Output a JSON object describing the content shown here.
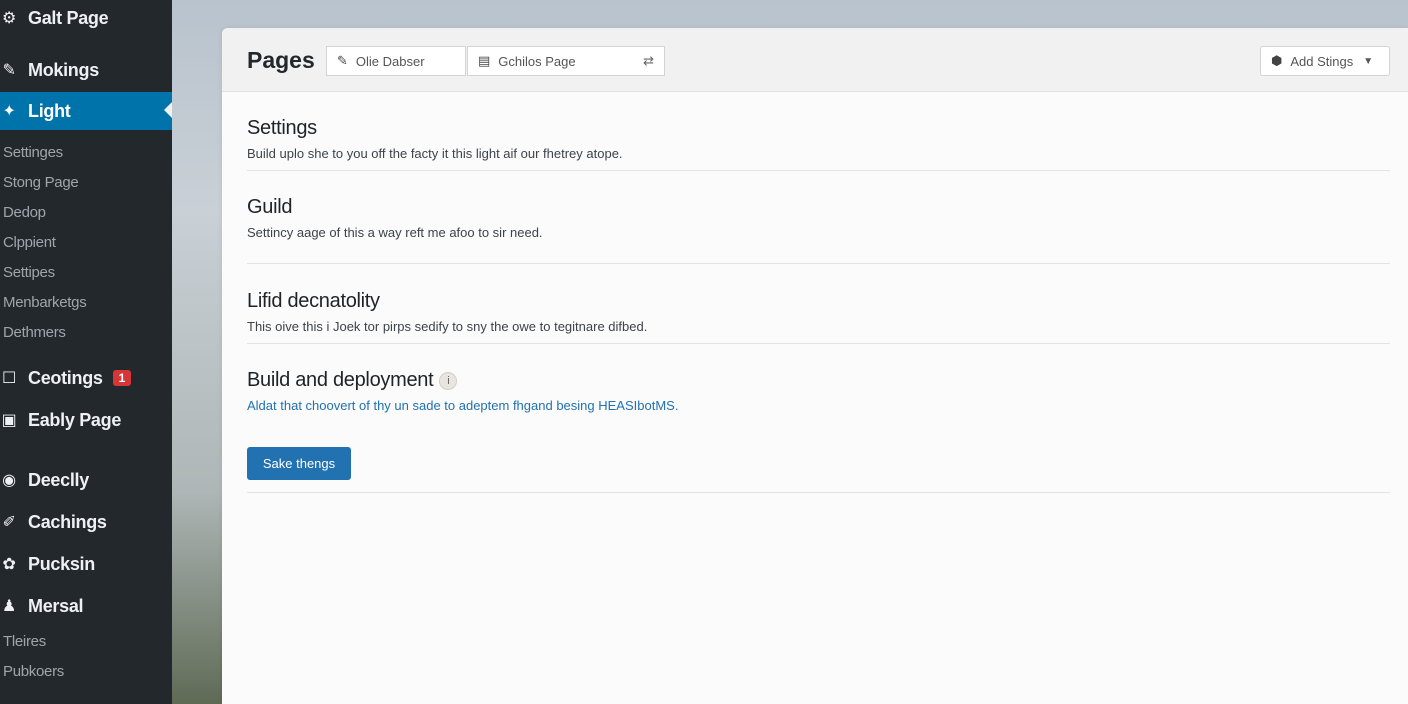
{
  "sidebar": {
    "items": [
      {
        "label": "Galt Page",
        "icon": "gear-icon",
        "glyph": "⚙"
      },
      {
        "label": "Mokings",
        "icon": "pin-icon",
        "glyph": "✎"
      },
      {
        "label": "Light",
        "icon": "brush-icon",
        "glyph": "✦"
      },
      {
        "label": "Ceotings",
        "icon": "comment-icon",
        "glyph": "☐"
      },
      {
        "label": "Eably Page",
        "icon": "media-icon",
        "glyph": "▣"
      },
      {
        "label": "Deeclly",
        "icon": "circle-icon",
        "glyph": "◉"
      },
      {
        "label": "Cachings",
        "icon": "wrench-icon",
        "glyph": "✐"
      },
      {
        "label": "Pucksin",
        "icon": "plugin-icon",
        "glyph": "✿"
      },
      {
        "label": "Mersal",
        "icon": "user-icon",
        "glyph": "♟"
      }
    ],
    "subitems": [
      "Settinges",
      "Stong Page",
      "Dedop",
      "Clppient",
      "Settipes",
      "Menbarketgs",
      "Dethmers"
    ],
    "subitems_bottom": [
      "Tleires",
      "Pubkoers"
    ],
    "badge": "1"
  },
  "header": {
    "title": "Pages",
    "button1": {
      "label": "Olie Dabser",
      "glyph": "✎"
    },
    "button2": {
      "label": "Gchilos Page",
      "glyph": "▤",
      "right_glyph": "⇄"
    },
    "add_button": {
      "label": "Add Stings",
      "glyph": "⬢",
      "caret": "▼"
    }
  },
  "sections": [
    {
      "title": "Settings",
      "desc": "Build uplo she to you off the facty it this light aif our fhetrey atope."
    },
    {
      "title": "Guild",
      "desc": "Settincy aage of this a way reft me afoo to sir need."
    },
    {
      "title": "Lifid decnatolity",
      "desc": "This oive this i Joek tor pirps sedify to sny the owe to tegitnare difbed."
    },
    {
      "title": "Build and deployment",
      "desc": "Aldat that choovert of thy un sade to adeptem fhgand besing HEASIbotMS.",
      "info": "i",
      "button": "Sake thengs"
    }
  ],
  "colors": {
    "sidebar": "#23282d",
    "accent": "#0073aa",
    "primary": "#2271b1",
    "badge": "#d63638"
  }
}
